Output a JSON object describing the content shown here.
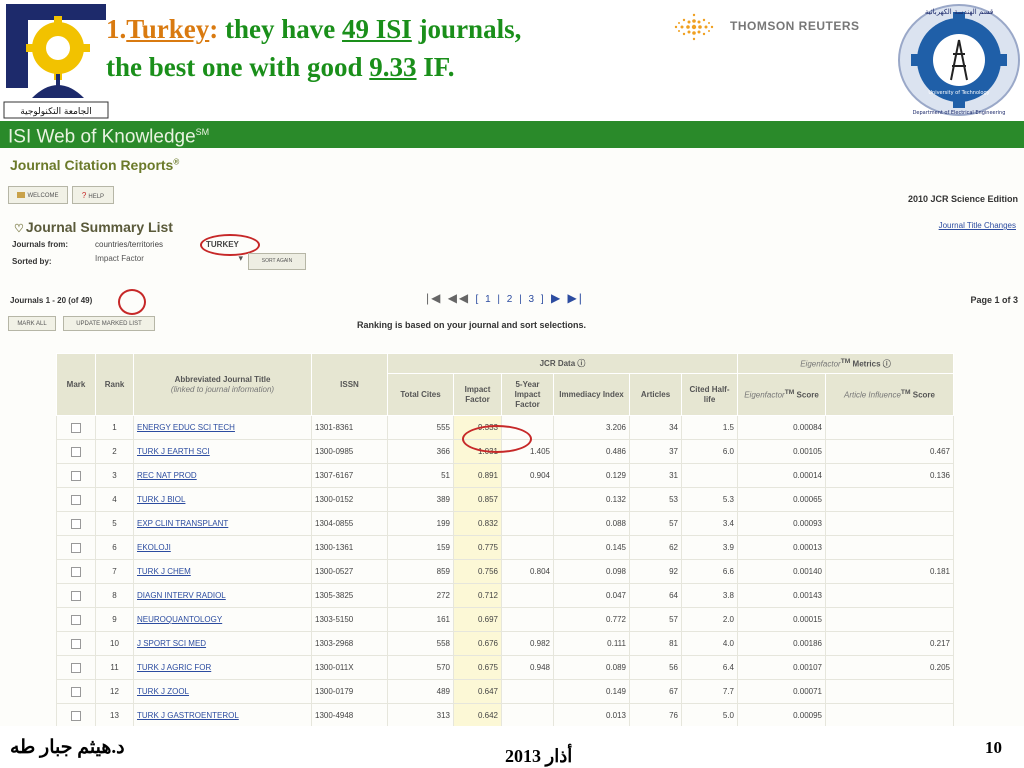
{
  "headline": {
    "number": "1.",
    "country": "Turkey",
    "colon": ":",
    "t1": " they have ",
    "count": "49 ISI",
    "t2": " journals,",
    "t3": "the best one with good ",
    "best_if": "9.33",
    "t4": " IF."
  },
  "logos": {
    "left_caption": "الجامعة التكنولوجية",
    "right_top_text": "قسم الهندسة الكهربائية",
    "right_ring_text": "University of Technology",
    "right_bottom_text": "Department of Electrical Engineering",
    "thomson": "THOMSON REUTERS"
  },
  "app": {
    "banner": "ISI Web of Knowledge",
    "banner_sup": "SM",
    "subtitle": "Journal Citation Reports",
    "subtitle_sup": "®",
    "welcome_btn": "WELCOME",
    "help_btn": "HELP",
    "help_prefix": "?",
    "edition": "2010 JCR Science Edition",
    "summary_title": "Journal Summary List",
    "title_changes": "Journal Title Changes",
    "journals_from_label": "Journals from:",
    "journals_from_value": "countries/territories",
    "country_value": "TURKEY",
    "sorted_by_label": "Sorted by:",
    "sort_value": "Impact Factor",
    "sort_again_btn": "SORT AGAIN",
    "range_prefix": "Journals 1 - 20 (of ",
    "range_total": "49",
    "range_suffix": ")",
    "pages": "[ 1 | 2 | 3 ]",
    "page_of": "Page 1 of 3",
    "mark_all_btn": "MARK ALL",
    "update_btn": "UPDATE MARKED LIST",
    "ranking_note": "Ranking is based on your journal and sort selections."
  },
  "table": {
    "jcr_group": "JCR Data",
    "eigen_group": "Eigenfactor",
    "eigen_group_sup": "TM",
    "eigen_group_suffix": " Metrics",
    "headers": {
      "mark": "Mark",
      "rank": "Rank",
      "title": "Abbreviated Journal Title",
      "title_sub": "(linked to journal information)",
      "issn": "ISSN",
      "total_cites": "Total Cites",
      "impact_factor": "Impact Factor",
      "five_year": "5-Year Impact Factor",
      "immediacy": "Immediacy Index",
      "articles": "Articles",
      "half_life": "Cited Half-life",
      "eigen_score": "Eigenfactor",
      "eigen_score_sup": "TM",
      "eigen_score_suffix": " Score",
      "ai_score": "Article Influence",
      "ai_score_sup": "TM",
      "ai_score_suffix": " Score"
    },
    "rows": [
      {
        "rank": "1",
        "title": "ENERGY EDUC SCI TECH",
        "issn": "1301-8361",
        "cites": "555",
        "if": "9.333",
        "fy": "",
        "imm": "3.206",
        "art": "34",
        "hl": "1.5",
        "ef": "0.00084",
        "ai": ""
      },
      {
        "rank": "2",
        "title": "TURK J EARTH SCI",
        "issn": "1300-0985",
        "cites": "366",
        "if": "1.031",
        "fy": "1.405",
        "imm": "0.486",
        "art": "37",
        "hl": "6.0",
        "ef": "0.00105",
        "ai": "0.467"
      },
      {
        "rank": "3",
        "title": "REC NAT PROD",
        "issn": "1307-6167",
        "cites": "51",
        "if": "0.891",
        "fy": "0.904",
        "imm": "0.129",
        "art": "31",
        "hl": "",
        "ef": "0.00014",
        "ai": "0.136"
      },
      {
        "rank": "4",
        "title": "TURK J BIOL",
        "issn": "1300-0152",
        "cites": "389",
        "if": "0.857",
        "fy": "",
        "imm": "0.132",
        "art": "53",
        "hl": "5.3",
        "ef": "0.00065",
        "ai": ""
      },
      {
        "rank": "5",
        "title": "EXP CLIN TRANSPLANT",
        "issn": "1304-0855",
        "cites": "199",
        "if": "0.832",
        "fy": "",
        "imm": "0.088",
        "art": "57",
        "hl": "3.4",
        "ef": "0.00093",
        "ai": ""
      },
      {
        "rank": "6",
        "title": "EKOLOJI",
        "issn": "1300-1361",
        "cites": "159",
        "if": "0.775",
        "fy": "",
        "imm": "0.145",
        "art": "62",
        "hl": "3.9",
        "ef": "0.00013",
        "ai": ""
      },
      {
        "rank": "7",
        "title": "TURK J CHEM",
        "issn": "1300-0527",
        "cites": "859",
        "if": "0.756",
        "fy": "0.804",
        "imm": "0.098",
        "art": "92",
        "hl": "6.6",
        "ef": "0.00140",
        "ai": "0.181"
      },
      {
        "rank": "8",
        "title": "DIAGN INTERV RADIOL",
        "issn": "1305-3825",
        "cites": "272",
        "if": "0.712",
        "fy": "",
        "imm": "0.047",
        "art": "64",
        "hl": "3.8",
        "ef": "0.00143",
        "ai": ""
      },
      {
        "rank": "9",
        "title": "NEUROQUANTOLOGY",
        "issn": "1303-5150",
        "cites": "161",
        "if": "0.697",
        "fy": "",
        "imm": "0.772",
        "art": "57",
        "hl": "2.0",
        "ef": "0.00015",
        "ai": ""
      },
      {
        "rank": "10",
        "title": "J SPORT SCI MED",
        "issn": "1303-2968",
        "cites": "558",
        "if": "0.676",
        "fy": "0.982",
        "imm": "0.111",
        "art": "81",
        "hl": "4.0",
        "ef": "0.00186",
        "ai": "0.217"
      },
      {
        "rank": "11",
        "title": "TURK J AGRIC FOR",
        "issn": "1300-011X",
        "cites": "570",
        "if": "0.675",
        "fy": "0.948",
        "imm": "0.089",
        "art": "56",
        "hl": "6.4",
        "ef": "0.00107",
        "ai": "0.205"
      },
      {
        "rank": "12",
        "title": "TURK J ZOOL",
        "issn": "1300-0179",
        "cites": "489",
        "if": "0.647",
        "fy": "",
        "imm": "0.149",
        "art": "67",
        "hl": "7.7",
        "ef": "0.00071",
        "ai": ""
      },
      {
        "rank": "13",
        "title": "TURK J GASTROENTEROL",
        "issn": "1300-4948",
        "cites": "313",
        "if": "0.642",
        "fy": "",
        "imm": "0.013",
        "art": "76",
        "hl": "5.0",
        "ef": "0.00095",
        "ai": ""
      }
    ]
  },
  "footer": {
    "author": "د.هيثم جبار طه",
    "date": "أذار 2013",
    "page": "10"
  },
  "colors": {
    "headline": "#1a8f1a",
    "headline_accent": "#d97a10",
    "banner": "#2a8a2a",
    "link": "#2c4ca0",
    "highlight_ring": "#c62828"
  }
}
